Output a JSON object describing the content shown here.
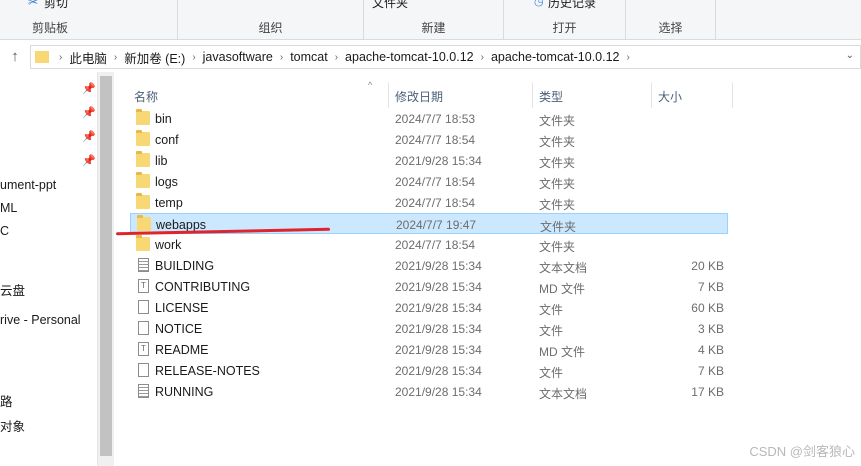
{
  "ribbon": {
    "cut_label": "剪切",
    "group_clipboard": "剪贴板",
    "group_organize": "组织",
    "new_item_label": "文件夹",
    "group_new": "新建",
    "history_label": "历史记录",
    "group_open": "打开",
    "group_select": "选择"
  },
  "address": {
    "crumbs": [
      "此电脑",
      "新加卷 (E:)",
      "javasoftware",
      "tomcat",
      "apache-tomcat-10.0.12",
      "apache-tomcat-10.0.12"
    ]
  },
  "nav": {
    "items": [
      "ument-ppt",
      "ML",
      "C",
      "云盘",
      "rive - Personal",
      "路",
      "对象"
    ]
  },
  "columns": {
    "name": "名称",
    "date": "修改日期",
    "type": "类型",
    "size": "大小"
  },
  "files": [
    {
      "name": "bin",
      "date": "2024/7/7 18:53",
      "type": "文件夹",
      "size": "",
      "icon": "folder-icon"
    },
    {
      "name": "conf",
      "date": "2024/7/7 18:54",
      "type": "文件夹",
      "size": "",
      "icon": "folder-icon"
    },
    {
      "name": "lib",
      "date": "2021/9/28 15:34",
      "type": "文件夹",
      "size": "",
      "icon": "folder-icon"
    },
    {
      "name": "logs",
      "date": "2024/7/7 18:54",
      "type": "文件夹",
      "size": "",
      "icon": "folder-icon"
    },
    {
      "name": "temp",
      "date": "2024/7/7 18:54",
      "type": "文件夹",
      "size": "",
      "icon": "folder-icon"
    },
    {
      "name": "webapps",
      "date": "2024/7/7 19:47",
      "type": "文件夹",
      "size": "",
      "icon": "folder-icon",
      "selected": true
    },
    {
      "name": "work",
      "date": "2024/7/7 18:54",
      "type": "文件夹",
      "size": "",
      "icon": "folder-icon"
    },
    {
      "name": "BUILDING",
      "date": "2021/9/28 15:34",
      "type": "文本文档",
      "size": "20 KB",
      "icon": "text-file-icon"
    },
    {
      "name": "CONTRIBUTING",
      "date": "2021/9/28 15:34",
      "type": "MD 文件",
      "size": "7 KB",
      "icon": "md-file-icon"
    },
    {
      "name": "LICENSE",
      "date": "2021/9/28 15:34",
      "type": "文件",
      "size": "60 KB",
      "icon": "file-icon"
    },
    {
      "name": "NOTICE",
      "date": "2021/9/28 15:34",
      "type": "文件",
      "size": "3 KB",
      "icon": "file-icon"
    },
    {
      "name": "README",
      "date": "2021/9/28 15:34",
      "type": "MD 文件",
      "size": "4 KB",
      "icon": "md-file-icon"
    },
    {
      "name": "RELEASE-NOTES",
      "date": "2021/9/28 15:34",
      "type": "文件",
      "size": "7 KB",
      "icon": "file-icon"
    },
    {
      "name": "RUNNING",
      "date": "2021/9/28 15:34",
      "type": "文本文档",
      "size": "17 KB",
      "icon": "text-file-icon"
    }
  ],
  "watermark": "CSDN @剑客狼心",
  "colors": {
    "selection": "#cce8ff",
    "selection_border": "#99d1ff",
    "folder": "#f8d775",
    "annotation": "#e0242c"
  }
}
